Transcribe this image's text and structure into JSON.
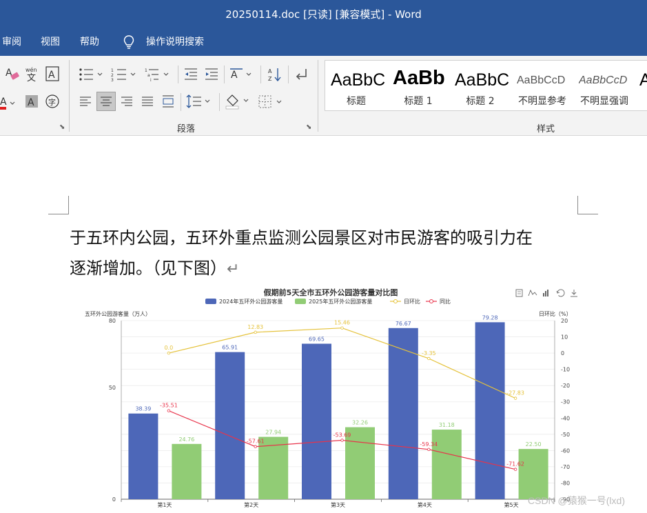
{
  "window": {
    "title": "20250114.doc [只读] [兼容模式]  -  Word"
  },
  "tabs": {
    "review": "审阅",
    "view": "视图",
    "help": "帮助",
    "tell_me": "操作说明搜索"
  },
  "ribbon": {
    "paragraph_label": "段落",
    "styles_label": "样式",
    "styles": [
      {
        "sample": "AaBbC",
        "name": "标题"
      },
      {
        "sample": "AaBb",
        "name": "标题 1"
      },
      {
        "sample": "AaBbC",
        "name": "标题 2"
      },
      {
        "sample": "AaBbCcD",
        "name": "不明显参考"
      },
      {
        "sample": "AaBbCcD",
        "name": "不明显强调"
      }
    ]
  },
  "document": {
    "line1": "于五环内公园，五环外重点监测公园景区对市民游客的吸引力在",
    "line2": "逐渐增加。（见下图）",
    "paragraph_mark": "↵"
  },
  "chart_data": {
    "type": "bar",
    "title": "假期前5天全市五环外公园游客量对比图",
    "ylabel": "五环外公园游客量（万人）",
    "y2label": "日环比（%）",
    "categories": [
      "第1天",
      "第2天",
      "第3天",
      "第4天",
      "第5天"
    ],
    "ylim": [
      0,
      80
    ],
    "yticks": [
      0,
      50,
      80
    ],
    "y2lim": [
      -90,
      20
    ],
    "y2ticks": [
      20,
      10,
      0,
      -10,
      -20,
      -30,
      -40,
      -50,
      -60,
      -70,
      -80,
      -90
    ],
    "grid": true,
    "legend_position": "top",
    "series": [
      {
        "name": "2024年五环外公园游客量",
        "kind": "bar",
        "color": "#4d67b8",
        "values": [
          38.39,
          65.91,
          69.65,
          76.67,
          79.28
        ],
        "labels": [
          "38.39",
          "65.91",
          "69.65",
          "76.67",
          "79.28"
        ]
      },
      {
        "name": "2025年五环外公园游客量",
        "kind": "bar",
        "color": "#91cc75",
        "values": [
          24.76,
          27.94,
          32.26,
          31.18,
          22.5
        ],
        "labels": [
          "24.76",
          "27.94",
          "32.26",
          "31.18",
          "22.50"
        ]
      },
      {
        "name": "日环比",
        "kind": "line",
        "axis": "right",
        "color": "#e5c23a",
        "values": [
          0.0,
          12.83,
          15.46,
          -3.35,
          -27.83
        ],
        "labels": [
          "0.0",
          "12.83",
          "15.46",
          "-3.35",
          "-27.83"
        ]
      },
      {
        "name": "同比",
        "kind": "line",
        "axis": "right",
        "color": "#e8334a",
        "values": [
          -35.51,
          -57.61,
          -53.69,
          -59.34,
          -71.62
        ],
        "labels": [
          "-35.51",
          "-57.61",
          "-53.69",
          "-59.34",
          "-71.62"
        ]
      }
    ]
  },
  "watermark": "CSDN @猿猴一号(lxd)"
}
